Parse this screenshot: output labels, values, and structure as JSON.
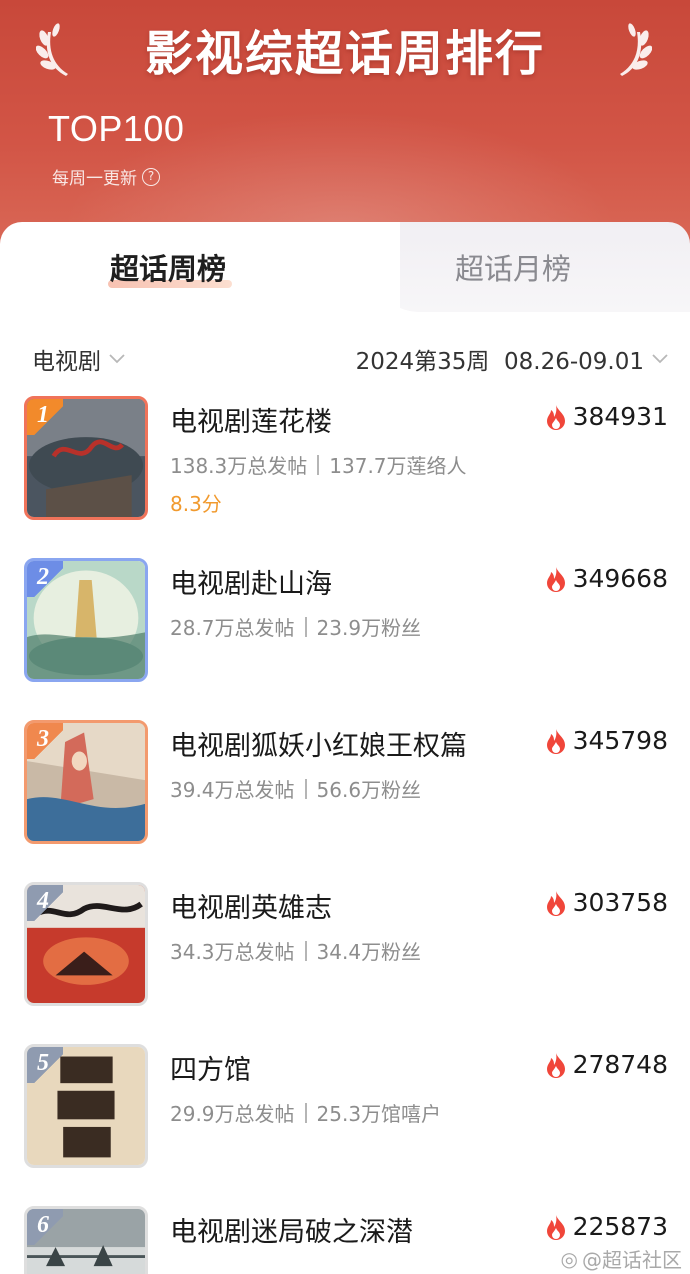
{
  "header": {
    "title": "影视综超话周排行",
    "top_label": "TOP100",
    "update_note": "每周一更新",
    "help_icon": "question-circle-icon"
  },
  "tabs": [
    {
      "label": "超话周榜",
      "active": true
    },
    {
      "label": "超话月榜",
      "active": false
    }
  ],
  "filters": {
    "category": "电视剧",
    "period": "2024第35周  08.26-09.01"
  },
  "colors": {
    "banner": "#c8483a",
    "score": "#f19a2e",
    "fire": "#f0463a"
  },
  "rankings": [
    {
      "rank": "1",
      "name": "电视剧莲花楼",
      "posts": "138.3万总发帖",
      "fans": "137.7万莲络人",
      "score": "8.3分",
      "heat": "384931",
      "badge_color": "#f28a2b",
      "border_color": "#f0735a"
    },
    {
      "rank": "2",
      "name": "电视剧赴山海",
      "posts": "28.7万总发帖",
      "fans": "23.9万粉丝",
      "score": "",
      "heat": "349668",
      "badge_color": "#6d8de6",
      "border_color": "#8aa6f0"
    },
    {
      "rank": "3",
      "name": "电视剧狐妖小红娘王权篇",
      "posts": "39.4万总发帖",
      "fans": "56.6万粉丝",
      "score": "",
      "heat": "345798",
      "badge_color": "#f0884e",
      "border_color": "#f39a6e"
    },
    {
      "rank": "4",
      "name": "电视剧英雄志",
      "posts": "34.3万总发帖",
      "fans": "34.4万粉丝",
      "score": "",
      "heat": "303758",
      "badge_color": "#8f9bb0",
      "border_color": "#dedede"
    },
    {
      "rank": "5",
      "name": "四方馆",
      "posts": "29.9万总发帖",
      "fans": "25.3万馆嘻户",
      "score": "",
      "heat": "278748",
      "badge_color": "#8f9bb0",
      "border_color": "#dedede"
    },
    {
      "rank": "6",
      "name": "电视剧迷局破之深潜",
      "posts": "",
      "fans": "",
      "score": "",
      "heat": "225873",
      "badge_color": "#8f9bb0",
      "border_color": "#dedede"
    }
  ],
  "watermark": "@超话社区"
}
